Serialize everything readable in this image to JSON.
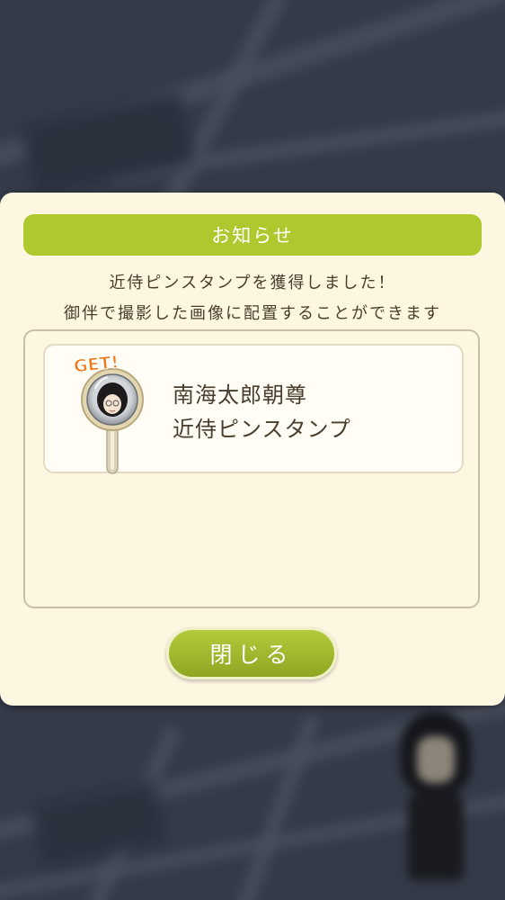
{
  "dialog": {
    "title": "お知らせ",
    "message_line1": "近侍ピンスタンプを獲得しました！",
    "message_line2": "御伴で撮影した画像に配置することができます",
    "item": {
      "badge": "GET!",
      "name_line1": "南海太郎朝尊",
      "name_line2": "近侍ピンスタンプ"
    },
    "close_label": "閉じる"
  },
  "colors": {
    "accent_green": "#aec92e",
    "panel_bg": "#fdf7e2",
    "text_brown": "#4a3d2c",
    "badge_orange": "#f07a1a"
  }
}
